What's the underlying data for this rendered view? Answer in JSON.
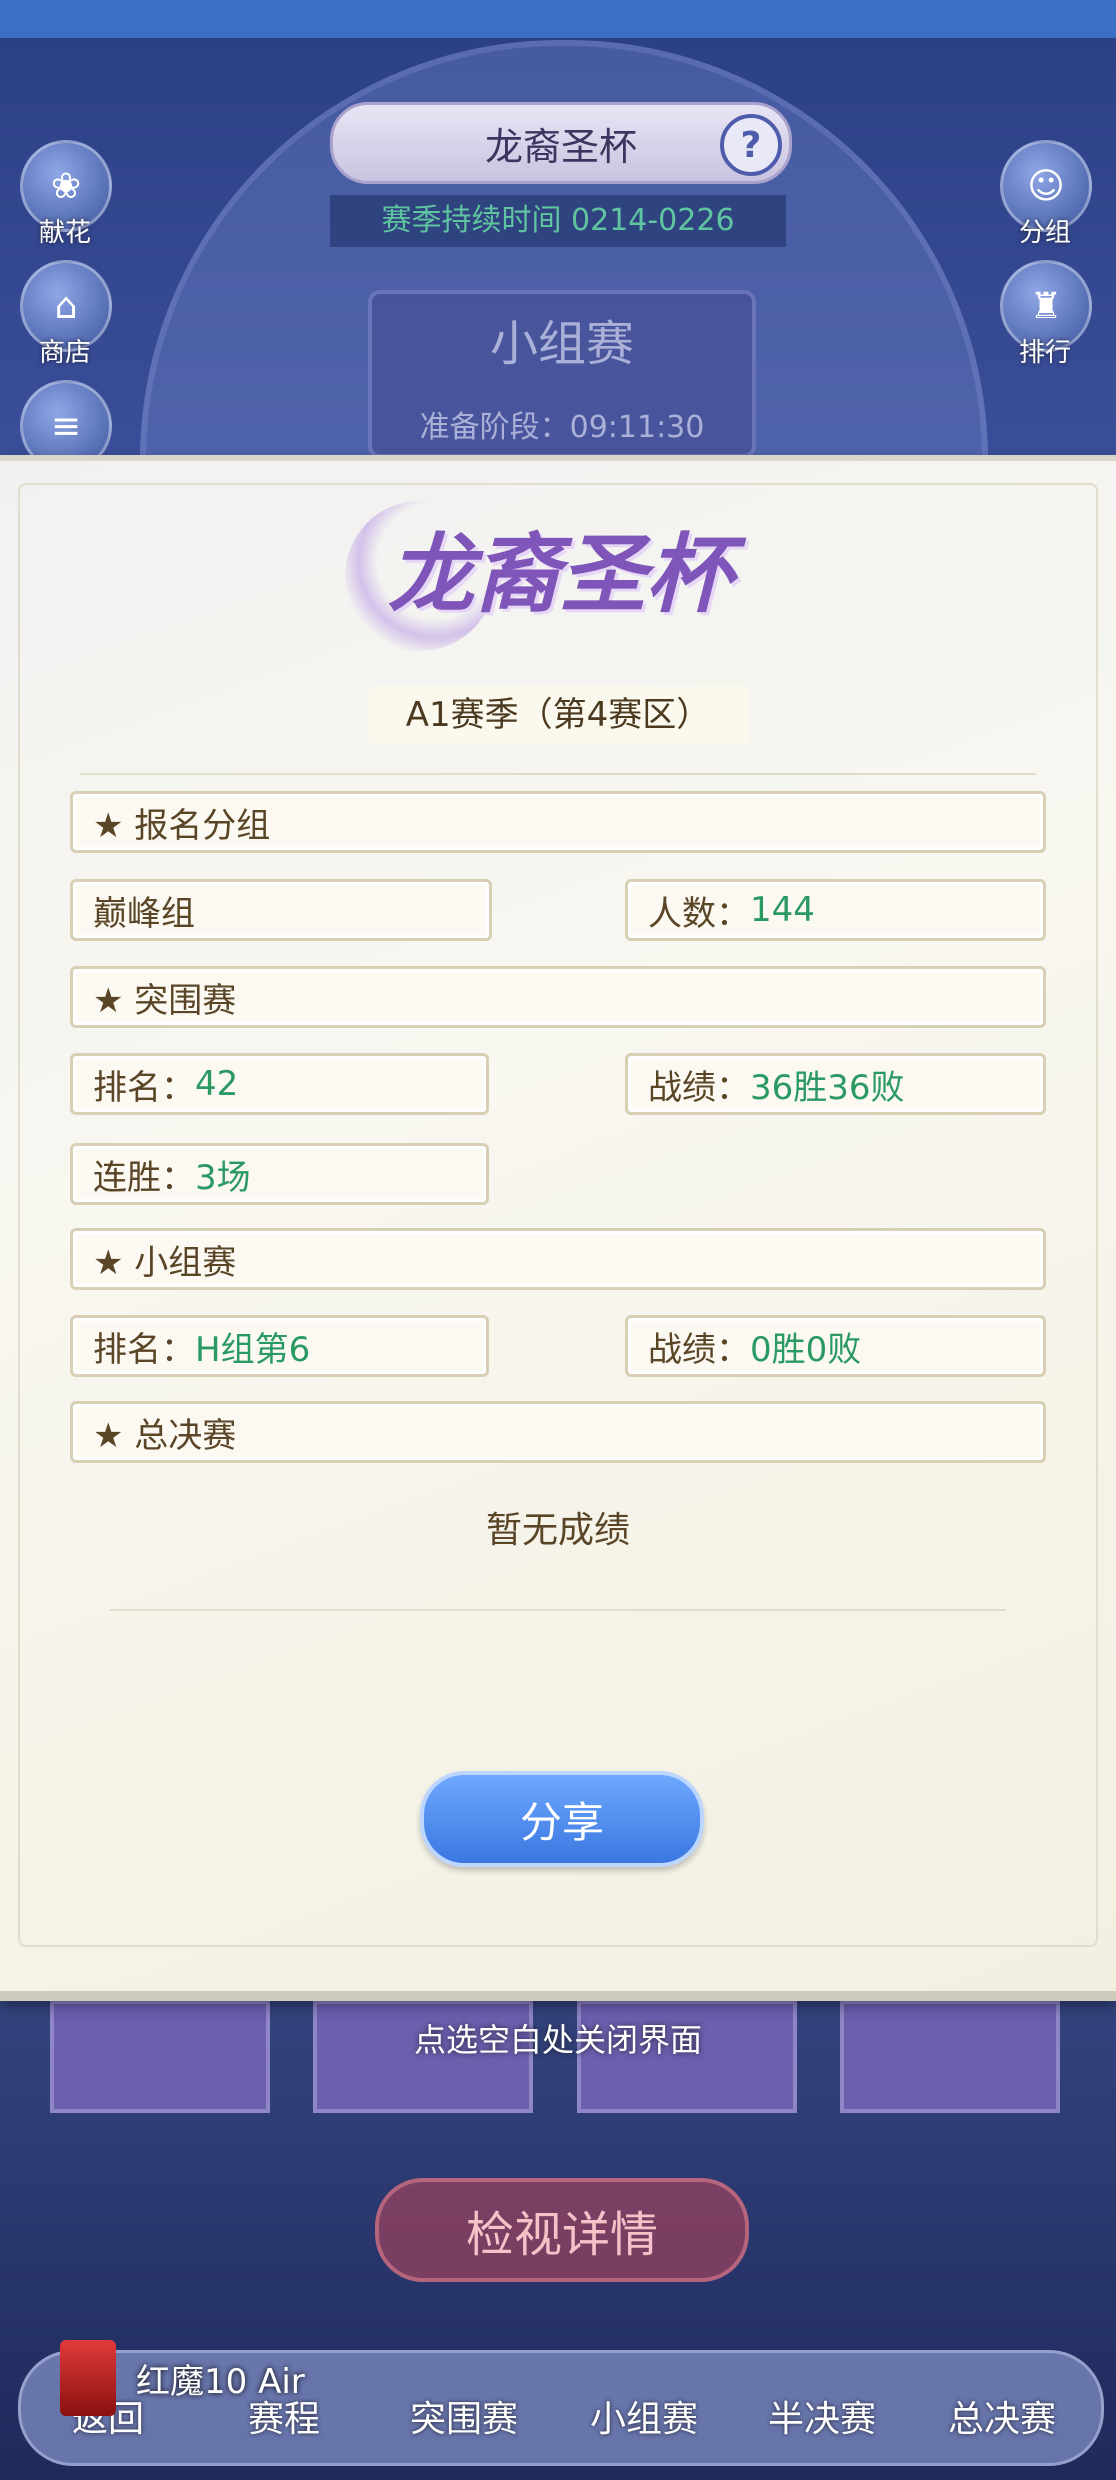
{
  "background": {
    "title": "龙裔圣杯",
    "season_time": "赛季持续时间 0214-0226",
    "stage_name": "小组赛",
    "prep_stage": "准备阶段：09:11:30",
    "left_icons": [
      "献花",
      "商店"
    ],
    "right_icons": [
      "分组",
      "排行"
    ],
    "detail_button": "检视详情"
  },
  "card": {
    "logo_text": "龙裔圣杯",
    "season_name": "A1赛季（第4赛区）",
    "sections": {
      "signup": "★ 报名分组",
      "breakout": "★ 突围赛",
      "group": "★ 小组赛",
      "final": "★ 总决赛"
    },
    "signup_group": "巅峰组",
    "signup_count_label": "人数：",
    "signup_count_value": "144",
    "breakout_rank_label": "排名：",
    "breakout_rank_value": "42",
    "breakout_record_label": "战绩：",
    "breakout_record_value": "36胜36败",
    "breakout_streak_label": "连胜：",
    "breakout_streak_value": "3场",
    "group_rank_label": "排名：",
    "group_rank_value": "H组第6",
    "group_record_label": "战绩：",
    "group_record_value": "0胜0败",
    "final_no_result": "暂无成绩",
    "share_button": "分享"
  },
  "close_hint": "点选空白处关闭界面",
  "nav": {
    "back": "返回",
    "schedule": "赛程",
    "breakout": "突围赛",
    "group": "小组赛",
    "semifinal": "半决赛",
    "final": "总决赛"
  },
  "device_brand": "红魔10 Air",
  "colors": {
    "value_green": "#2b9963",
    "share_blue": "#3a77e0",
    "logo_purple": "#7f55b9"
  }
}
